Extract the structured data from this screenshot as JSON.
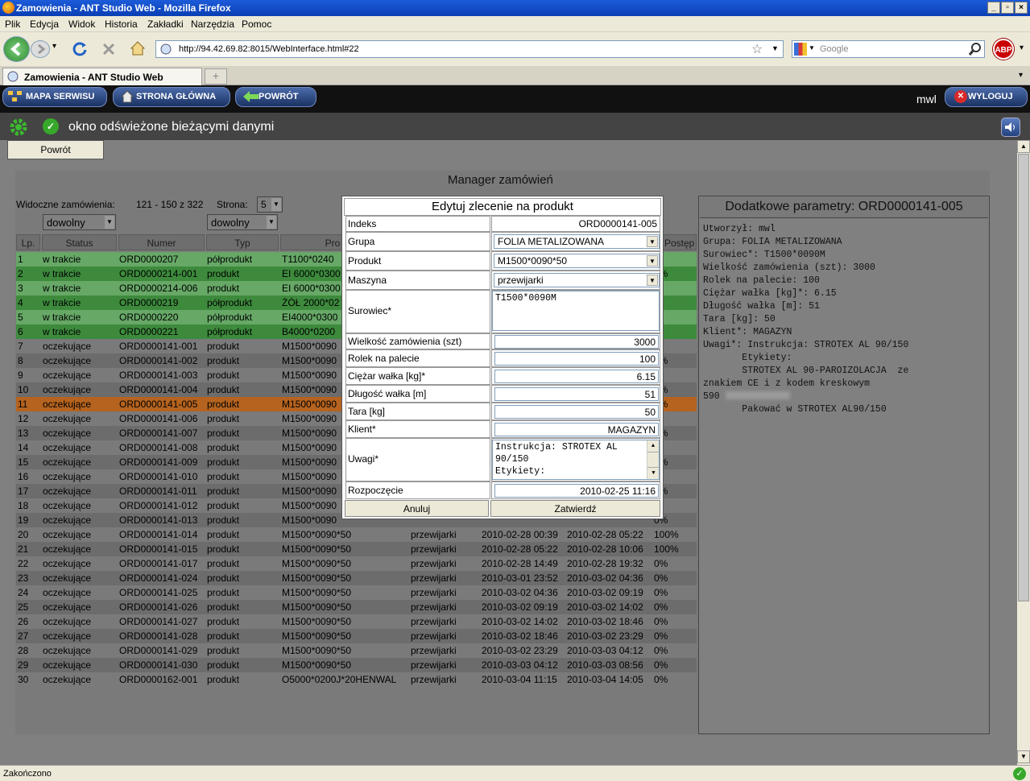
{
  "window": {
    "title": "Zamowienia - ANT Studio Web - Mozilla Firefox"
  },
  "menu": [
    "Plik",
    "Edycja",
    "Widok",
    "Historia",
    "Zakładki",
    "Narzędzia",
    "Pomoc"
  ],
  "nav": {
    "url": "http://94.42.69.82:8015/WebInterface.html#22",
    "search_placeholder": "Google"
  },
  "tab": {
    "label": "Zamowienia - ANT Studio Web"
  },
  "site": {
    "btn_map": "MAPA SERWISU",
    "btn_home": "STRONA GŁÓWNA",
    "btn_back": "POWRÓT",
    "user": "mwl",
    "btn_logout": "WYLOGUJ",
    "status": "okno odświeżone bieżącymi danymi"
  },
  "page": {
    "back_btn": "Powrót",
    "status_bar": "Zakończono"
  },
  "manager": {
    "title": "Manager zamówień",
    "visible_label": "Widoczne zamówienia:",
    "visible_range": "121 - 150 z 322",
    "page_label": "Strona:",
    "page_value": "5",
    "filter_status": "dowolny",
    "filter_type": "dowolny",
    "headers": {
      "lp": "Lp.",
      "status": "Status",
      "numer": "Numer",
      "typ": "Typ",
      "produkt": "Pro",
      "postep": "Postęp"
    },
    "rows": [
      {
        "lp": "1",
        "status": "w trakcie",
        "numer": "ORD0000207",
        "typ": "półprodukt",
        "produkt": "T1100*0240",
        "maszyna": "",
        "start": "",
        "end": "",
        "postep": "%",
        "color": "#67a867"
      },
      {
        "lp": "2",
        "status": "w trakcie",
        "numer": "ORD0000214-001",
        "typ": "produkt",
        "produkt": "EI 6000*0300",
        "maszyna": "",
        "start": "",
        "end": "",
        "postep": "0%",
        "color": "#3d8a3d"
      },
      {
        "lp": "3",
        "status": "w trakcie",
        "numer": "ORD0000214-006",
        "typ": "produkt",
        "produkt": "EI 6000*0300",
        "maszyna": "",
        "start": "",
        "end": "",
        "postep": "%",
        "color": "#67a867"
      },
      {
        "lp": "4",
        "status": "w trakcie",
        "numer": "ORD0000219",
        "typ": "półprodukt",
        "produkt": "ŻÓŁ 2000*02",
        "maszyna": "",
        "start": "",
        "end": "",
        "postep": "%",
        "color": "#3d8a3d"
      },
      {
        "lp": "5",
        "status": "w trakcie",
        "numer": "ORD0000220",
        "typ": "półprodukt",
        "produkt": "EI4000*0300",
        "maszyna": "",
        "start": "",
        "end": "",
        "postep": "%",
        "color": "#67a867"
      },
      {
        "lp": "6",
        "status": "w trakcie",
        "numer": "ORD0000221",
        "typ": "półprodukt",
        "produkt": "B4000*0200",
        "maszyna": "",
        "start": "",
        "end": "",
        "postep": "%",
        "color": "#3d8a3d"
      },
      {
        "lp": "7",
        "status": "oczekujące",
        "numer": "ORD0000141-001",
        "typ": "produkt",
        "produkt": "M1500*0090",
        "maszyna": "",
        "start": "",
        "end": "",
        "postep": "%",
        "color": "#7a7a7a"
      },
      {
        "lp": "8",
        "status": "oczekujące",
        "numer": "ORD0000141-002",
        "typ": "produkt",
        "produkt": "M1500*0090",
        "maszyna": "",
        "start": "",
        "end": "",
        "postep": "0%",
        "color": "#6c6c6c"
      },
      {
        "lp": "9",
        "status": "oczekujące",
        "numer": "ORD0000141-003",
        "typ": "produkt",
        "produkt": "M1500*0090",
        "maszyna": "",
        "start": "",
        "end": "",
        "postep": "%",
        "color": "#7a7a7a"
      },
      {
        "lp": "10",
        "status": "oczekujące",
        "numer": "ORD0000141-004",
        "typ": "produkt",
        "produkt": "M1500*0090",
        "maszyna": "",
        "start": "",
        "end": "",
        "postep": "0%",
        "color": "#6c6c6c"
      },
      {
        "lp": "11",
        "status": "oczekujące",
        "numer": "ORD0000141-005",
        "typ": "produkt",
        "produkt": "M1500*0090",
        "maszyna": "",
        "start": "",
        "end": "",
        "postep": "0%",
        "color": "#b5631e"
      },
      {
        "lp": "12",
        "status": "oczekujące",
        "numer": "ORD0000141-006",
        "typ": "produkt",
        "produkt": "M1500*0090",
        "maszyna": "",
        "start": "",
        "end": "",
        "postep": "%",
        "color": "#7a7a7a"
      },
      {
        "lp": "13",
        "status": "oczekujące",
        "numer": "ORD0000141-007",
        "typ": "produkt",
        "produkt": "M1500*0090",
        "maszyna": "",
        "start": "",
        "end": "",
        "postep": "0%",
        "color": "#6c6c6c"
      },
      {
        "lp": "14",
        "status": "oczekujące",
        "numer": "ORD0000141-008",
        "typ": "produkt",
        "produkt": "M1500*0090",
        "maszyna": "",
        "start": "",
        "end": "",
        "postep": "%",
        "color": "#7a7a7a"
      },
      {
        "lp": "15",
        "status": "oczekujące",
        "numer": "ORD0000141-009",
        "typ": "produkt",
        "produkt": "M1500*0090",
        "maszyna": "",
        "start": "",
        "end": "",
        "postep": "0%",
        "color": "#6c6c6c"
      },
      {
        "lp": "16",
        "status": "oczekujące",
        "numer": "ORD0000141-010",
        "typ": "produkt",
        "produkt": "M1500*0090",
        "maszyna": "",
        "start": "",
        "end": "",
        "postep": "%",
        "color": "#7a7a7a"
      },
      {
        "lp": "17",
        "status": "oczekujące",
        "numer": "ORD0000141-011",
        "typ": "produkt",
        "produkt": "M1500*0090",
        "maszyna": "",
        "start": "",
        "end": "",
        "postep": "0%",
        "color": "#6c6c6c"
      },
      {
        "lp": "18",
        "status": "oczekujące",
        "numer": "ORD0000141-012",
        "typ": "produkt",
        "produkt": "M1500*0090",
        "maszyna": "",
        "start": "",
        "end": "",
        "postep": "%",
        "color": "#7a7a7a"
      },
      {
        "lp": "19",
        "status": "oczekujące",
        "numer": "ORD0000141-013",
        "typ": "produkt",
        "produkt": "M1500*0090",
        "maszyna": "",
        "start": "",
        "end": "",
        "postep": "0%",
        "color": "#6c6c6c"
      },
      {
        "lp": "20",
        "status": "oczekujące",
        "numer": "ORD0000141-014",
        "typ": "produkt",
        "produkt": "M1500*0090*50",
        "maszyna": "przewijarki",
        "start": "2010-02-28 00:39",
        "end": "2010-02-28 05:22",
        "postep": "100%",
        "color": "#7a7a7a"
      },
      {
        "lp": "21",
        "status": "oczekujące",
        "numer": "ORD0000141-015",
        "typ": "produkt",
        "produkt": "M1500*0090*50",
        "maszyna": "przewijarki",
        "start": "2010-02-28 05:22",
        "end": "2010-02-28 10:06",
        "postep": "100%",
        "color": "#6c6c6c"
      },
      {
        "lp": "22",
        "status": "oczekujące",
        "numer": "ORD0000141-017",
        "typ": "produkt",
        "produkt": "M1500*0090*50",
        "maszyna": "przewijarki",
        "start": "2010-02-28 14:49",
        "end": "2010-02-28 19:32",
        "postep": "0%",
        "color": "#7a7a7a"
      },
      {
        "lp": "23",
        "status": "oczekujące",
        "numer": "ORD0000141-024",
        "typ": "produkt",
        "produkt": "M1500*0090*50",
        "maszyna": "przewijarki",
        "start": "2010-03-01 23:52",
        "end": "2010-03-02 04:36",
        "postep": "0%",
        "color": "#6c6c6c"
      },
      {
        "lp": "24",
        "status": "oczekujące",
        "numer": "ORD0000141-025",
        "typ": "produkt",
        "produkt": "M1500*0090*50",
        "maszyna": "przewijarki",
        "start": "2010-03-02 04:36",
        "end": "2010-03-02 09:19",
        "postep": "0%",
        "color": "#7a7a7a"
      },
      {
        "lp": "25",
        "status": "oczekujące",
        "numer": "ORD0000141-026",
        "typ": "produkt",
        "produkt": "M1500*0090*50",
        "maszyna": "przewijarki",
        "start": "2010-03-02 09:19",
        "end": "2010-03-02 14:02",
        "postep": "0%",
        "color": "#6c6c6c"
      },
      {
        "lp": "26",
        "status": "oczekujące",
        "numer": "ORD0000141-027",
        "typ": "produkt",
        "produkt": "M1500*0090*50",
        "maszyna": "przewijarki",
        "start": "2010-03-02 14:02",
        "end": "2010-03-02 18:46",
        "postep": "0%",
        "color": "#7a7a7a"
      },
      {
        "lp": "27",
        "status": "oczekujące",
        "numer": "ORD0000141-028",
        "typ": "produkt",
        "produkt": "M1500*0090*50",
        "maszyna": "przewijarki",
        "start": "2010-03-02 18:46",
        "end": "2010-03-02 23:29",
        "postep": "0%",
        "color": "#6c6c6c"
      },
      {
        "lp": "28",
        "status": "oczekujące",
        "numer": "ORD0000141-029",
        "typ": "produkt",
        "produkt": "M1500*0090*50",
        "maszyna": "przewijarki",
        "start": "2010-03-02 23:29",
        "end": "2010-03-03 04:12",
        "postep": "0%",
        "color": "#7a7a7a"
      },
      {
        "lp": "29",
        "status": "oczekujące",
        "numer": "ORD0000141-030",
        "typ": "produkt",
        "produkt": "M1500*0090*50",
        "maszyna": "przewijarki",
        "start": "2010-03-03 04:12",
        "end": "2010-03-03 08:56",
        "postep": "0%",
        "color": "#6c6c6c"
      },
      {
        "lp": "30",
        "status": "oczekujące",
        "numer": "ORD0000162-001",
        "typ": "produkt",
        "produkt": "O5000*0200J*20HENWAL",
        "maszyna": "przewijarki",
        "start": "2010-03-04 11:15",
        "end": "2010-03-04 14:05",
        "postep": "0%",
        "color": "#7a7a7a"
      }
    ]
  },
  "dialog": {
    "title": "Edytuj zlecenie na produkt",
    "indeks_label": "Indeks",
    "indeks": "ORD0000141-005",
    "grupa_label": "Grupa",
    "grupa": "FOLIA METALIZOWANA",
    "produkt_label": "Produkt",
    "produkt": "M1500*0090*50",
    "maszyna_label": "Maszyna",
    "maszyna": "przewijarki",
    "surowiec_label": "Surowiec*",
    "surowiec": "T1500*0090M",
    "wielkosc_label": "Wielkość zamówienia (szt)",
    "wielkosc": "3000",
    "rolek_label": "Rolek na palecie",
    "rolek": "100",
    "ciezar_label": "Ciężar wałka [kg]*",
    "ciezar": "6.15",
    "dlugosc_label": "Długość wałka [m]",
    "dlugosc": "51",
    "tara_label": "Tara [kg]",
    "tara": "50",
    "klient_label": "Klient*",
    "klient": "MAGAZYN",
    "uwagi_label": "Uwagi*",
    "uwagi_l1": "Instrukcja: STROTEX AL",
    "uwagi_l2": "90/150",
    "uwagi_l3": "Etykiety:",
    "start_label": "Rozpoczęcie",
    "start": "2010-02-25 11:16",
    "cancel": "Anuluj",
    "confirm": "Zatwierdź"
  },
  "params": {
    "title": "Dodatkowe parametry: ORD0000141-005",
    "lines": [
      "Utworzył: mwl",
      "Grupa: FOLIA METALIZOWANA",
      "Surowiec*: T1500*0090M",
      "Wielkość zamówienia (szt): 3000",
      "Rolek na palecie: 100",
      "Ciężar wałka [kg]*: 6.15",
      "Długość wałka [m]: 51",
      "Tara [kg]: 50",
      "Klient*: MAGAZYN",
      "Uwagi*: Instrukcja: STROTEX AL 90/150",
      "       Etykiety:",
      "       STROTEX AL 90-PAROIZOLACJA  ze",
      "znakiem CE i z kodem kreskowym",
      "590",
      "       Pakować w STROTEX AL90/150"
    ]
  }
}
